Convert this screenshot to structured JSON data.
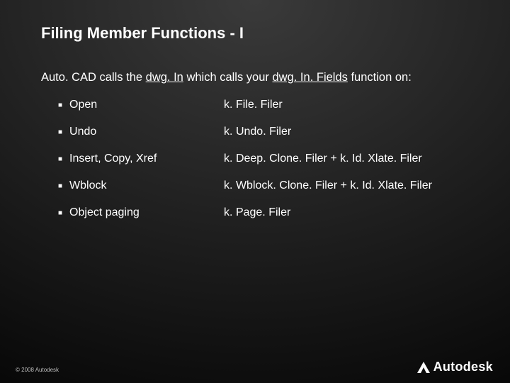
{
  "title": "Filing Member Functions - I",
  "intro": {
    "pre": "Auto. CAD calls the ",
    "u1": "dwg. In",
    "mid": " which calls your ",
    "u2": "dwg. In. Fields",
    "post": " function on:"
  },
  "rows": [
    {
      "left": "Open",
      "right": "k. File. Filer"
    },
    {
      "left": "Undo",
      "right": "k. Undo. Filer"
    },
    {
      "left": "Insert, Copy, Xref",
      "right": "k. Deep. Clone. Filer + k. Id. Xlate. Filer"
    },
    {
      "left": "Wblock",
      "right": "k. Wblock. Clone. Filer + k. Id. Xlate. Filer"
    },
    {
      "left": "Object paging",
      "right": " k. Page. Filer"
    }
  ],
  "footer": "© 2008 Autodesk",
  "logo": "Autodesk"
}
